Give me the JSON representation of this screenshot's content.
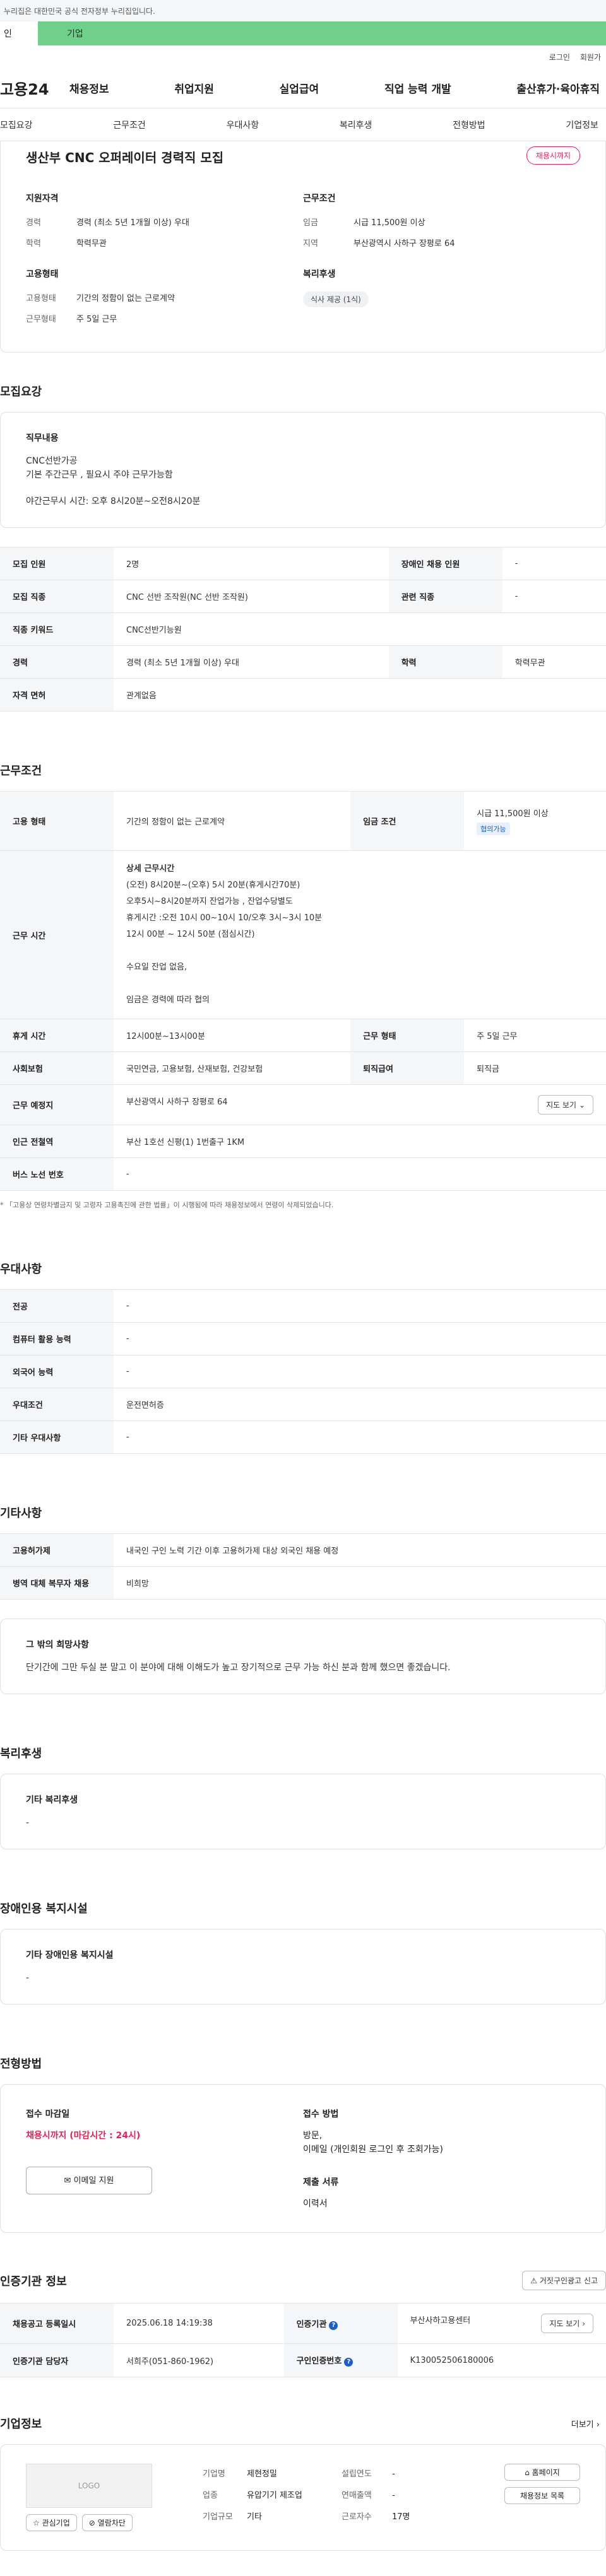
{
  "gov_notice": "누리집은 대한민국 공식 전자정부 누리집입니다.",
  "top_tabs": [
    "인",
    "기업"
  ],
  "util": [
    "로그인",
    "회원가"
  ],
  "logo": "고용24",
  "gnb": [
    "채용정보",
    "취업지원",
    "실업급여",
    "직업 능력 개발",
    "출산휴가·육아휴직"
  ],
  "subnav": [
    "모집요강",
    "근무조건",
    "우대사항",
    "복리후생",
    "전형방법",
    "기업정보"
  ],
  "summary": {
    "title": "생산부 CNC 오퍼레이터 경력직 모집",
    "badge": "채용시까지",
    "qual_title": "지원자격",
    "career_k": "경력",
    "career_v": "경력 (최소 5년 1개월 이상) 우대",
    "edu_k": "학력",
    "edu_v": "학력무관",
    "emp_title": "고용형태",
    "emptype_k": "고용형태",
    "emptype_v": "기간의 정함이 없는 근로계약",
    "worktype_k": "근무형태",
    "worktype_v": "주 5일 근무",
    "cond_title": "근무조건",
    "wage_k": "임금",
    "wage_v": "시급 11,500원 이상",
    "region_k": "지역",
    "region_v": "부산광역시 사하구 장평로 64",
    "welfare_title": "복리후생",
    "welfare_chip": "식사 제공 (1식)"
  },
  "recruit": {
    "title": "모집요강",
    "duty_title": "직무내용",
    "duty_l1": "CNC선반가공",
    "duty_l2": "기본 주간근무 , 필요시 주야 근무가능함",
    "duty_l3": "야간근무시 시간: 오후 8시20분~오전8시20분",
    "rows": [
      [
        "모집 인원",
        "2명",
        "장애인 채용 인원",
        "-"
      ],
      [
        "모집 직종",
        "CNC 선반 조작원(NC 선반 조작원)",
        "관련 직종",
        "-"
      ],
      [
        "직종 키워드",
        "CNC선반기능원"
      ],
      [
        "경력",
        "경력 (최소 5년 1개월 이상) 우대",
        "학력",
        "학력무관"
      ],
      [
        "자격 면허",
        "관계없음"
      ]
    ]
  },
  "work": {
    "title": "근무조건",
    "emp_k": "고용 형태",
    "emp_v": "기간의 정함이 없는 근로계약",
    "wage_k": "임금 조건",
    "wage_v": "시급 11,500원 이상",
    "wage_tag": "협의가능",
    "time_k": "근무 시간",
    "time_lines": [
      "상세 근무시간",
      "(오전) 8시20분~(오후) 5시 20분(휴게시간70분)",
      "오후5시~8시20분까지 잔업가능 , 잔업수당별도",
      "휴게시간 :오전 10시 00~10시 10/오후 3시~3시 10분",
      "12시 00분 ~ 12시 50분 (점심시간)",
      "",
      "수요일 잔업 없음,",
      "",
      "임금은 경력에 따라 협의"
    ],
    "break_k": "휴게 시간",
    "break_v": "12시00분~13시00분",
    "form_k": "근무 형태",
    "form_v": "주 5일 근무",
    "ins_k": "사회보험",
    "ins_v": "국민연금, 고용보험, 산재보험, 건강보험",
    "ret_k": "퇴직급여",
    "ret_v": "퇴직금",
    "place_k": "근무 예정지",
    "place_v": "부산광역시 사하구 장평로 64",
    "map_btn": "지도 보기",
    "subway_k": "인근 전철역",
    "subway_v": "부산 1호선 신평(1) 1번출구 1KM",
    "bus_k": "버스 노선 번호",
    "bus_v": "-",
    "note": "* 「고용상 연령차별금지 및 고령자 고용촉진에 관한 법률」이 시행됨에 따라 채용정보에서 연령이 삭제되었습니다."
  },
  "pref": {
    "title": "우대사항",
    "rows": [
      [
        "전공",
        "-"
      ],
      [
        "컴퓨터 활용 능력",
        "-"
      ],
      [
        "외국어 능력",
        "-"
      ],
      [
        "우대조건",
        "운전면허증"
      ],
      [
        "기타 우대사항",
        "-"
      ]
    ]
  },
  "etc": {
    "title": "기타사항",
    "rows": [
      [
        "고용허가제",
        "내국인 구인 노력 기간 이후 고용허가제 대상 외국인 채용 예정"
      ],
      [
        "병역 대체 복무자 채용",
        "비희망"
      ]
    ],
    "other_title": "그 밖의 희망사항",
    "other_text": "단기간에 그만 두실 분 말고 이 분야에 대해 이해도가 높고 장기적으로 근무 가능 하신 분과 함께 했으면 좋겠습니다."
  },
  "welfare": {
    "title": "복리후생",
    "sub": "기타 복리후생",
    "val": "-"
  },
  "disabled": {
    "title": "장애인용 복지시설",
    "sub": "기타 장애인용 복지시설",
    "val": "-"
  },
  "process": {
    "title": "전형방법",
    "deadline_k": "접수 마감일",
    "deadline_v": "채용시까지 (마감시간 : 24시)",
    "email_btn": "이메일 지원",
    "method_k": "접수 방법",
    "method_l1": "방문,",
    "method_l2": "이메일 (개인회원 로그인 후 조회가능)",
    "docs_k": "제출 서류",
    "docs_v": "이력서"
  },
  "cert": {
    "title": "인증기관 정보",
    "report_btn": "거짓구인광고 신고",
    "reg_k": "채용공고 등록일시",
    "reg_v": "2025.06.18 14:19:38",
    "org_k": "인증기관",
    "org_v": "부산사하고용센터",
    "map_btn": "지도 보기",
    "mgr_k": "인증기관 담당자",
    "mgr_v": "서희주(051-860-1962)",
    "num_k": "구인인증번호",
    "num_v": "K130052506180006"
  },
  "company": {
    "title": "기업정보",
    "more": "더보기",
    "logo": "LOGO",
    "fav": "관심기업",
    "block": "열람차단",
    "name_k": "기업명",
    "name_v": "제현정밀",
    "found_k": "설립연도",
    "found_v": "-",
    "ind_k": "업종",
    "ind_v": "유압기기 제조업",
    "sales_k": "연매출액",
    "sales_v": "-",
    "size_k": "기업규모",
    "size_v": "기타",
    "emp_k": "근로자수",
    "emp_v": "17명",
    "home_btn": "홈페이지",
    "list_btn": "채용정보 목록"
  }
}
